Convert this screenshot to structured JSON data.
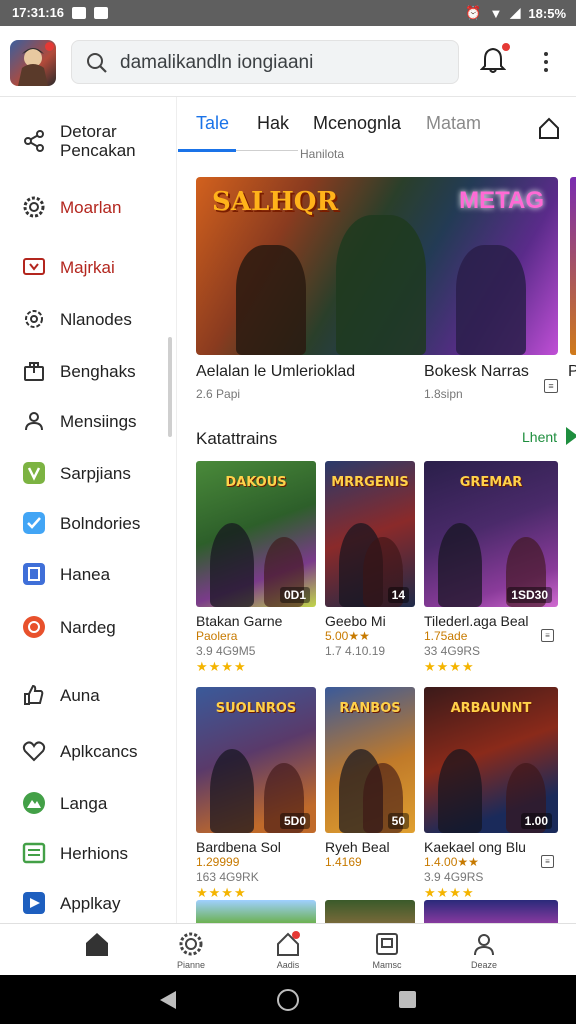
{
  "status_bar": {
    "time": "17:31:16",
    "battery": "18:5%"
  },
  "header": {
    "search_text": "damalikandln iongiaani"
  },
  "sidebar": {
    "items": [
      {
        "label": "Detorar\nPencakan",
        "icon": "share-icon",
        "color": "#333333",
        "text_color": "#222222"
      },
      {
        "label": "Moarlan",
        "icon": "gear-icon",
        "color": "#333333",
        "text_color": "#b3261e"
      },
      {
        "label": "Majrkai",
        "icon": "tv-icon",
        "color": "#b3261e",
        "text_color": "#b3261e"
      },
      {
        "label": "Nlanodes",
        "icon": "cog-outline-icon",
        "color": "#333333",
        "text_color": "#222222"
      },
      {
        "label": "Benghaks",
        "icon": "bag-icon",
        "color": "#333333",
        "text_color": "#222222"
      },
      {
        "label": "Mensiings",
        "icon": "people-icon",
        "color": "#333333",
        "text_color": "#222222"
      },
      {
        "label": "Sarpjians",
        "icon": "green-app-icon",
        "color": "#7cb342",
        "text_color": "#222222"
      },
      {
        "label": "Bolndories",
        "icon": "blue-check-icon",
        "color": "#42a5f5",
        "text_color": "#222222"
      },
      {
        "label": "Hanea",
        "icon": "music-icon",
        "color": "#3f6fd8",
        "text_color": "#222222"
      },
      {
        "label": "Nardeg",
        "icon": "globe-icon",
        "color": "#e8512c",
        "text_color": "#222222"
      },
      {
        "label": "Auna",
        "icon": "thumbs-up-icon",
        "color": "#333333",
        "text_color": "#222222"
      },
      {
        "label": "Aplkcancs",
        "icon": "heart-icon",
        "color": "#333333",
        "text_color": "#222222"
      },
      {
        "label": "Langa",
        "icon": "green-mountain-icon",
        "color": "#43a047",
        "text_color": "#222222"
      },
      {
        "label": "Herhions",
        "icon": "list-icon",
        "color": "#43a047",
        "text_color": "#222222"
      },
      {
        "label": "Applkay",
        "icon": "play-icon",
        "color": "#1e5fbf",
        "text_color": "#222222"
      }
    ]
  },
  "tabs": {
    "items": [
      "Tale",
      "Hak",
      "Mcenognla",
      "Matam"
    ],
    "sub_label": "Hanilota"
  },
  "hero": {
    "title_left": "SALHQR",
    "title_right": "METAG",
    "caption_left": "Aelalan le Umlerioklad",
    "sub_left": "2.6 Papi",
    "caption_right": "Bokesk Narras",
    "sub_right": "1.8sipn",
    "caption_edge": "P"
  },
  "section": {
    "title": "Katattrains",
    "more": "Lhent"
  },
  "cards_row1": [
    {
      "thumb_title": "DAKOUS",
      "badge": "0D1",
      "name": "Btakan Garne",
      "line2": "Paolera",
      "line3": "3.9 4G9M5",
      "stars": "★★★★",
      "bg": "linear-gradient(160deg,#4a8a3a,#2d5f2a 45%,#7a3b8a 75%,#c2d64a)"
    },
    {
      "thumb_title": "MRRGENIS",
      "badge": "14",
      "name": "Geebo Mi",
      "line2": "5.00★★",
      "line3": "1.7 4.10.19",
      "stars": "",
      "bg": "linear-gradient(160deg,#2a3a6a,#8a2a2a 50%,#1f2b4a)"
    },
    {
      "thumb_title": "GREMAR",
      "badge": "1SD30",
      "name": "Tilederl.aga Beal",
      "line2": "1.75ade",
      "line3": "33 4G9RS",
      "stars": "★★★★",
      "bg": "linear-gradient(160deg,#2a1f4a,#4a2a6a 45%,#8a3b9a 80%,#d06ad0)"
    }
  ],
  "cards_row2": [
    {
      "thumb_title": "SUOLNROS",
      "badge": "5D0",
      "name": "Bardbena Sol",
      "line2": "1.29999",
      "line3": "163 4G9RK",
      "stars": "★★★★",
      "bg": "linear-gradient(160deg,#3a5a9a,#5a3a6a 45%,#c06a2a 85%)"
    },
    {
      "thumb_title": "RANBOS",
      "badge": "50",
      "name": "Ryeh Beal",
      "line2": "1.4169",
      "line3": "",
      "stars": "",
      "bg": "linear-gradient(160deg,#3a5a9a,#c07a2a 55%,#e0a030)"
    },
    {
      "thumb_title": "ARBAUNNT",
      "badge": "1.00",
      "name": "Kaekael ong Blu",
      "line2": "1.4.00★★",
      "line3": "3.9 4G9RS",
      "stars": "★★★★",
      "bg": "linear-gradient(160deg,#3a1a1a,#8a2a1a 45%,#1a2a5a 80%)"
    }
  ],
  "cards_row3_colors": [
    "linear-gradient(180deg,#9fd0ff,#6ab04a)",
    "linear-gradient(180deg,#3a5a2a,#7a6a3a)",
    "linear-gradient(180deg,#2a2a7a,#8a3aa0)"
  ],
  "bottom_nav": {
    "items": [
      {
        "label": "",
        "icon": "home-icon"
      },
      {
        "label": "Pianne",
        "icon": "gear-icon"
      },
      {
        "label": "Aadis",
        "icon": "notification-icon"
      },
      {
        "label": "Mamsc",
        "icon": "library-icon"
      },
      {
        "label": "Deaze",
        "icon": "account-icon"
      }
    ]
  },
  "colors": {
    "accent": "#1a73e8",
    "more_green": "#1e8e3e",
    "star": "#f4b400"
  }
}
